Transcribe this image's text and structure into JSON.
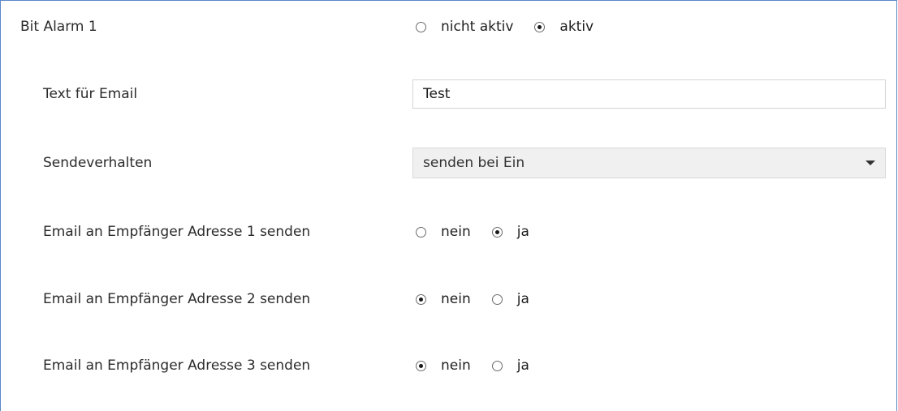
{
  "bit_alarm": {
    "label": "Bit Alarm 1",
    "options": [
      {
        "label": "nicht aktiv",
        "checked": false
      },
      {
        "label": "aktiv",
        "checked": true
      }
    ]
  },
  "email_text": {
    "label": "Text für Email",
    "value": "Test"
  },
  "send_behavior": {
    "label": "Sendeverhalten",
    "selected": "senden bei Ein"
  },
  "recipients": [
    {
      "label": "Email an Empfänger Adresse 1 senden",
      "options": [
        {
          "label": "nein",
          "checked": false
        },
        {
          "label": "ja",
          "checked": true
        }
      ]
    },
    {
      "label": "Email an Empfänger Adresse 2 senden",
      "options": [
        {
          "label": "nein",
          "checked": true
        },
        {
          "label": "ja",
          "checked": false
        }
      ]
    },
    {
      "label": "Email an Empfänger Adresse 3 senden",
      "options": [
        {
          "label": "nein",
          "checked": true
        },
        {
          "label": "ja",
          "checked": false
        }
      ]
    }
  ],
  "colors": {
    "border": "#5b87c6",
    "select_background": "#f0f0f0"
  }
}
